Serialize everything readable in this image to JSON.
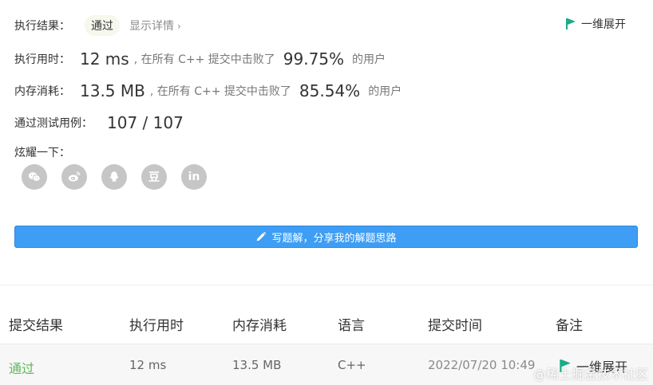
{
  "result": {
    "label": "执行结果：",
    "status": "通过",
    "details_link": "显示详情",
    "expand_label": "一维展开"
  },
  "runtime": {
    "label": "执行用时：",
    "value": "12 ms",
    "middle_text": ", 在所有 C++ 提交中击败了",
    "percent": "99.75%",
    "suffix": "的用户"
  },
  "memory": {
    "label": "内存消耗：",
    "value": "13.5 MB",
    "middle_text": ", 在所有 C++ 提交中击败了",
    "percent": "85.54%",
    "suffix": "的用户"
  },
  "tests": {
    "label": "通过测试用例：",
    "value": "107 / 107"
  },
  "share": {
    "label": "炫耀一下：",
    "icons": [
      "wechat-icon",
      "weibo-icon",
      "qq-icon",
      "douban-icon",
      "linkedin-icon"
    ],
    "douban_glyph": "豆",
    "linkedin_glyph": "in"
  },
  "write_button": {
    "label": "写题解，分享我的解题思路",
    "icon": "pencil-icon"
  },
  "table": {
    "headers": [
      "提交结果",
      "执行用时",
      "内存消耗",
      "语言",
      "提交时间",
      "备注"
    ],
    "rows": [
      {
        "result": "通过",
        "runtime": "12 ms",
        "memory": "13.5 MB",
        "language": "C++",
        "time": "2022/07/20 10:49",
        "note": "一维展开"
      }
    ]
  },
  "watermark": "@稀土掘金技术社区",
  "colors": {
    "accent": "#3e9ef5",
    "pass": "#5cb85c",
    "flag": "#1aab8a",
    "icon_bg": "#c6c6c6"
  }
}
